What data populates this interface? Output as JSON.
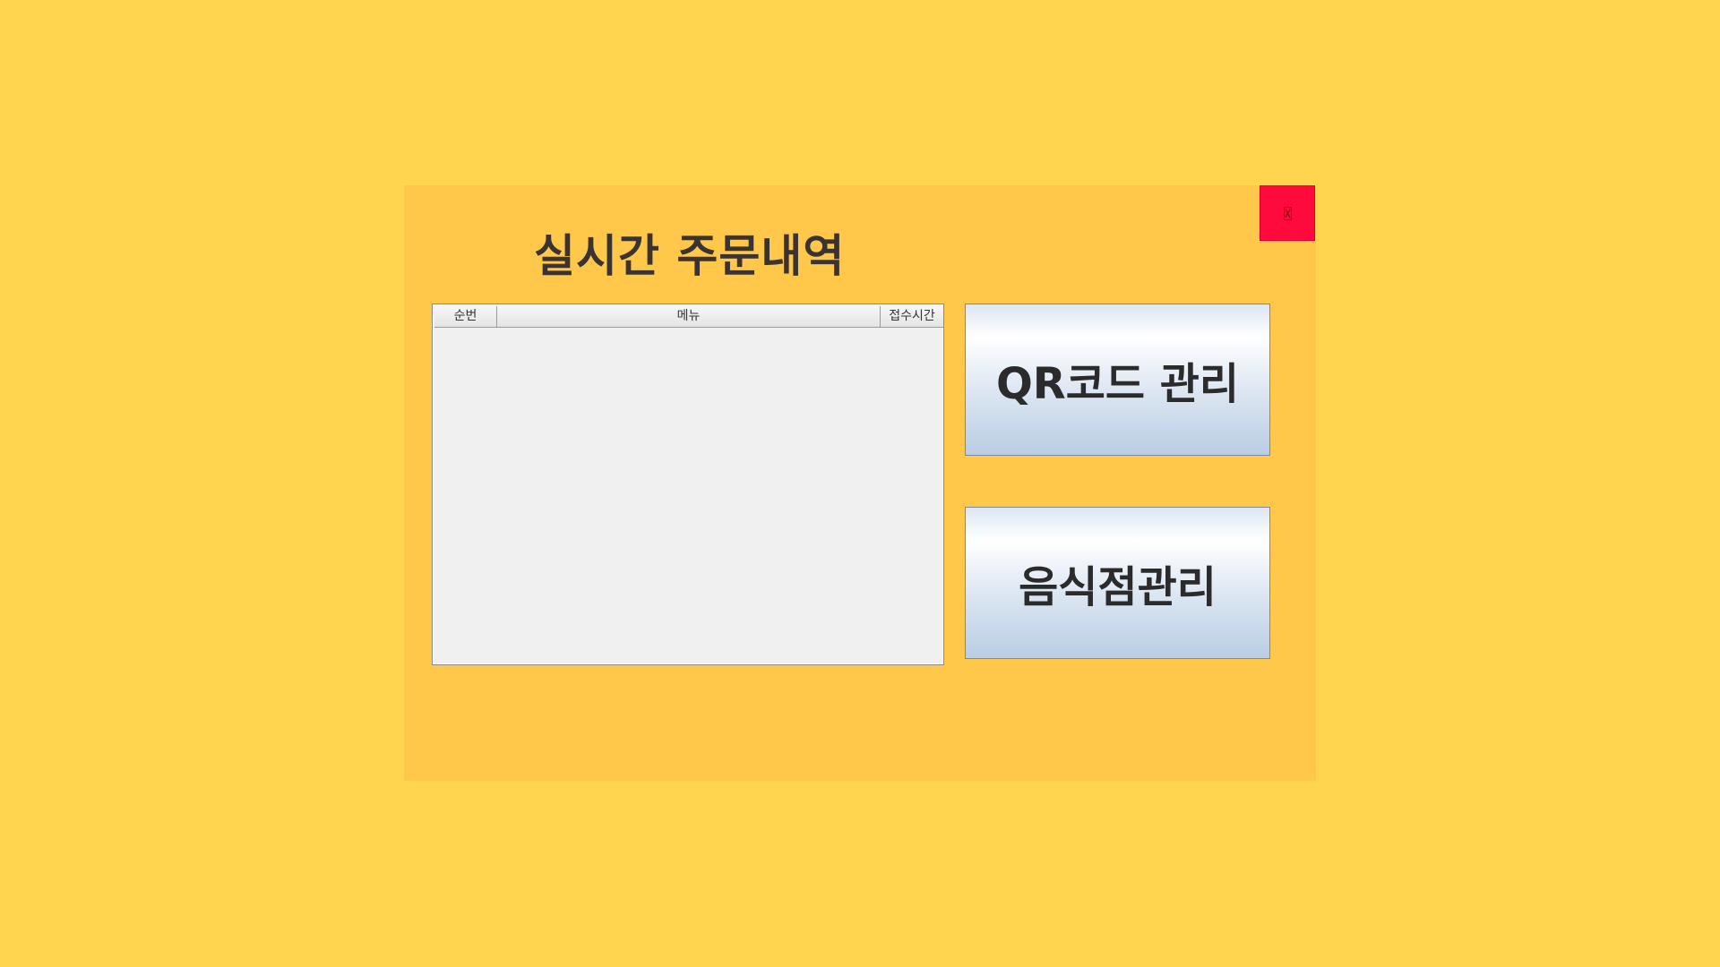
{
  "window": {
    "title": "실시간 주문내역",
    "close_button_icon": "close-icon"
  },
  "orders_table": {
    "columns": [
      "순번",
      "메뉴",
      "접수시간"
    ],
    "rows": []
  },
  "buttons": {
    "qr_label": "QR코드 관리",
    "store_label": "음식점관리"
  },
  "colors": {
    "background": "#FFD54F",
    "panel": "#FFC84B",
    "close_button": "#FF0A3C"
  }
}
